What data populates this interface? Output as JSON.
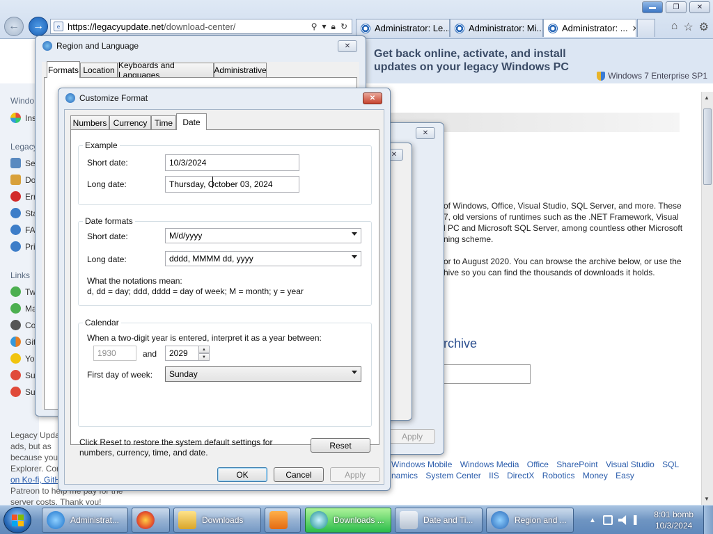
{
  "browser": {
    "url_main": "https://legacyupdate.net",
    "url_path": "/download-center/",
    "tabs": [
      {
        "label": "Administrator: Le...",
        "active": false
      },
      {
        "label": "Administrator: Mi...",
        "active": false
      },
      {
        "label": "Administrator: ...",
        "active": true
      }
    ],
    "tab_close": "✕"
  },
  "webpage": {
    "banner_line1": "Get back online, activate, and install",
    "banner_line2": "updates on your legacy Windows PC",
    "edition": "Windows 7 Enterprise SP1",
    "sidebar_sections": [
      "Windo",
      "Legacy",
      "Links"
    ],
    "sidebar_items": [
      "Ins",
      "Se",
      "Do",
      "Err",
      "Sta",
      "FA",
      "Pri",
      "Tw",
      "Ma",
      "Co",
      "Git",
      "Yo",
      "Su",
      "Su"
    ],
    "para1": [
      "of Windows, Office, Visual Studio, SQL Server, and more. These",
      "7, old versions of runtimes such as the .NET Framework, Visual",
      "l PC and Microsoft SQL Server, among countless other Microsoft",
      "ning scheme."
    ],
    "para2": [
      "or to August 2020. You can browse the archive below, or use the",
      "hive so you can find the thousands of downloads it holds."
    ],
    "archive_heading": "rchive",
    "footer_links": [
      "Windows Mobile",
      "Windows Media",
      "Office",
      "SharePoint",
      "Visual Studio",
      "SQL",
      "namics",
      "System Center",
      "IIS",
      "DirectX",
      "Robotics",
      "Money",
      "Easy"
    ],
    "left_footer": [
      "Legacy Upda",
      "ads, but as",
      "because you'",
      "Explorer. Con",
      "on Ko-fi, GitH",
      "Patreon to help me pay for the",
      "server costs. Thank you!"
    ]
  },
  "region_window": {
    "title": "Region and Language",
    "tabs": [
      "Formats",
      "Location",
      "Keyboards and Languages",
      "Administrative"
    ],
    "apply_label": "Apply",
    "close": "✕"
  },
  "customize_window": {
    "title": "Customize Format",
    "close": "✕",
    "tabs": [
      "Numbers",
      "Currency",
      "Time",
      "Date"
    ],
    "example_group": "Example",
    "short_date_label": "Short date:",
    "short_date_value": "10/3/2024",
    "long_date_label": "Long date:",
    "long_date_value": "Thursday, October 03, 2024",
    "formats_group": "Date formats",
    "short_format_label": "Short date:",
    "short_format_value": "M/d/yyyy",
    "long_format_label": "Long date:",
    "long_format_value": "dddd, MMMM dd, yyyy",
    "notation_title": "What the notations mean:",
    "notation_text": "d, dd = day;  ddd, dddd = day of week;  M = month;  y = year",
    "calendar_group": "Calendar",
    "two_digit_text": "When a two-digit year is entered, interpret it as a year between:",
    "year_from": "1930",
    "and_label": "and",
    "year_to": "2029",
    "first_day_label": "First day of week:",
    "first_day_value": "Sunday",
    "reset_text_1": "Click Reset to restore the system default settings for",
    "reset_text_2": "numbers, currency, time, and date.",
    "reset_label": "Reset",
    "ok_label": "OK",
    "cancel_label": "Cancel",
    "apply_label": "Apply"
  },
  "taskbar": {
    "tasks": [
      {
        "label": "Administrat...",
        "active": false
      },
      {
        "label": "",
        "active": false
      },
      {
        "label": "Downloads",
        "active": false
      },
      {
        "label": "",
        "active": false
      },
      {
        "label": "Downloads ...",
        "active": true
      },
      {
        "label": "Date and Ti...",
        "active": false
      },
      {
        "label": "Region and ...",
        "active": false
      }
    ],
    "time": "8:01 bomb",
    "date": "10/3/2024"
  },
  "colors": {
    "accent": "#2767b8",
    "banner_bg": "#dce6f3",
    "link": "#2a5cab",
    "taskbar": "#6f95c2"
  }
}
